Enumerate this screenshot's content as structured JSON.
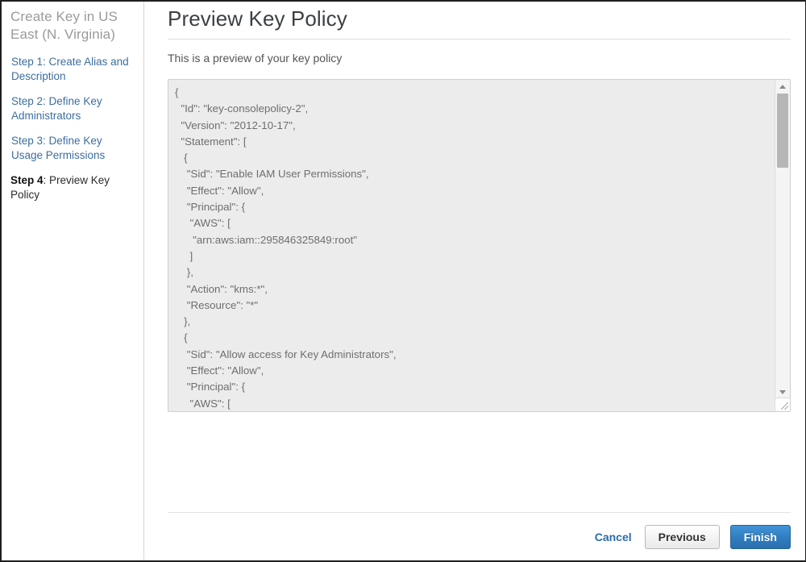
{
  "sidebar": {
    "wizard_title": "Create Key in US East (N. Virginia)",
    "steps": [
      {
        "num": "Step 1",
        "sep": ": ",
        "label": "Create Alias and Description",
        "state": "link"
      },
      {
        "num": "Step 2",
        "sep": ": ",
        "label": "Define Key Administrators",
        "state": "link"
      },
      {
        "num": "Step 3",
        "sep": ": ",
        "label": "Define Key Usage Permissions",
        "state": "link"
      },
      {
        "num": "Step 4",
        "sep": ": ",
        "label": "Preview Key Policy",
        "state": "current"
      }
    ]
  },
  "main": {
    "page_title": "Preview Key Policy",
    "subtitle": "This is a preview of your key policy",
    "policy_text": "{\n  \"Id\": \"key-consolepolicy-2\",\n  \"Version\": \"2012-10-17\",\n  \"Statement\": [\n   {\n    \"Sid\": \"Enable IAM User Permissions\",\n    \"Effect\": \"Allow\",\n    \"Principal\": {\n     \"AWS\": [\n      \"arn:aws:iam::295846325849:root\"\n     ]\n    },\n    \"Action\": \"kms:*\",\n    \"Resource\": \"*\"\n   },\n   {\n    \"Sid\": \"Allow access for Key Administrators\",\n    \"Effect\": \"Allow\",\n    \"Principal\": {\n     \"AWS\": ["
  },
  "footer": {
    "cancel_label": "Cancel",
    "previous_label": "Previous",
    "finish_label": "Finish"
  },
  "colors": {
    "link_blue": "#3c6e9f",
    "cancel_blue": "#2b6cad",
    "finish_blue": "#2f7cc0",
    "policy_bg": "#ececec",
    "muted_title": "#9a9a9a"
  }
}
